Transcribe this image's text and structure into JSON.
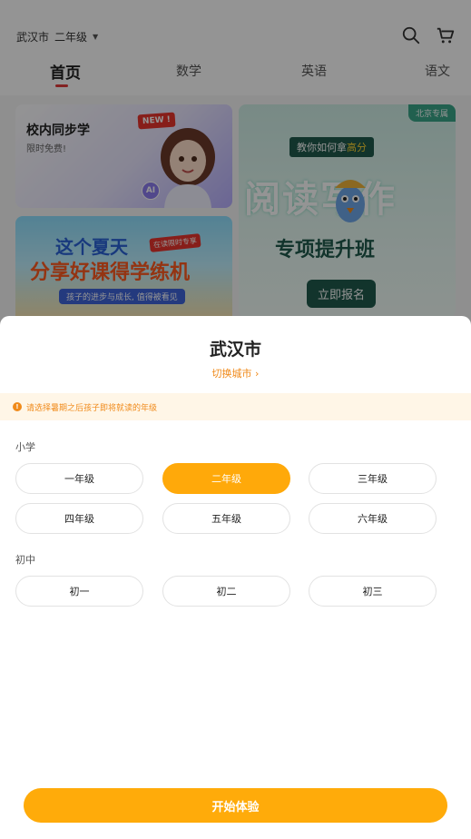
{
  "header": {
    "city": "武汉市",
    "grade": "二年级",
    "tabs": [
      {
        "label": "首页",
        "active": true
      },
      {
        "label": "数学"
      },
      {
        "label": "英语"
      },
      {
        "label": "语文"
      }
    ]
  },
  "banners": {
    "sync_title": "校内同步学",
    "sync_sub": "限时免费!",
    "new_badge": "NEW !",
    "ai_badge": "AI",
    "summer_line1": "这个夏天",
    "summer_tag": "在读限时专享",
    "summer_line2": "分享好课得学练机",
    "summer_line3": "孩子的进步与成长, 值得被看见",
    "read_tag": "北京专属",
    "read_line1_prefix": "教你如何拿",
    "read_line1_highlight": "高分",
    "read_line2": "阅读写作",
    "read_line3": "专项提升班",
    "read_button": "立即报名"
  },
  "sheet": {
    "title": "武汉市",
    "switch_city": "切换城市",
    "notice": "请选择暑期之后孩子即将就读的年级",
    "primary_label": "小学",
    "primary_grades": [
      "一年级",
      "二年级",
      "三年级",
      "四年级",
      "五年级",
      "六年级"
    ],
    "selected_grade": "二年级",
    "junior_label": "初中",
    "junior_grades": [
      "初一",
      "初二",
      "初三"
    ],
    "start_button": "开始体验"
  },
  "colors": {
    "accent": "#ffa90a",
    "notice_text": "#f08a1a",
    "notice_bg": "#fff6e7",
    "tab_underline": "#e23b3b"
  }
}
